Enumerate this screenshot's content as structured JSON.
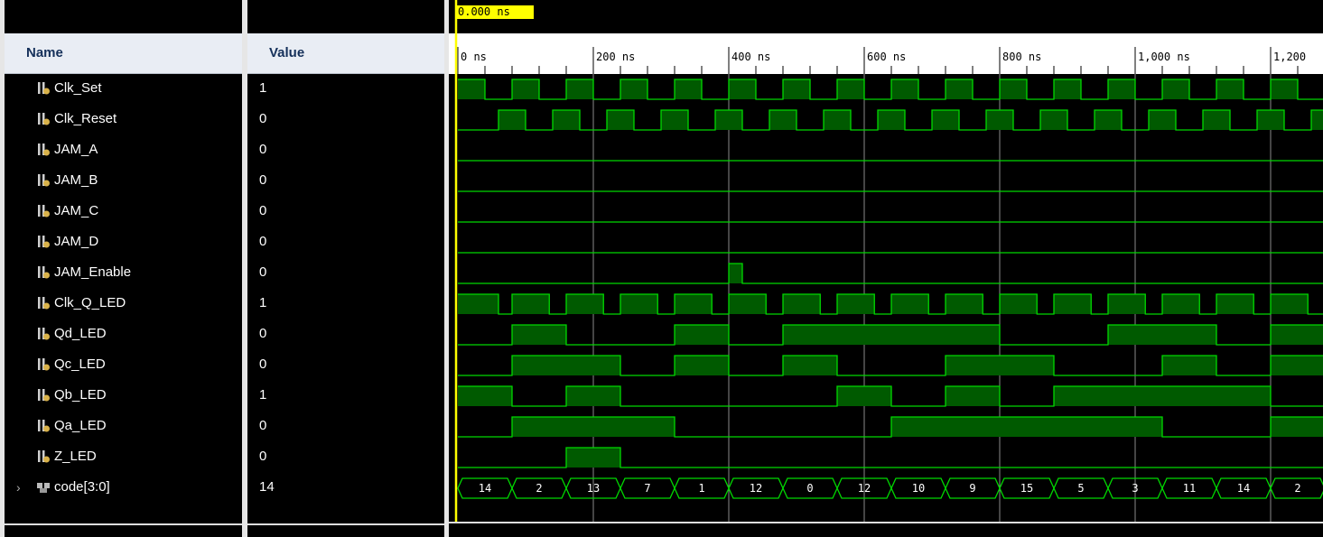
{
  "cursor_label": "0.000 ns",
  "columns": {
    "name": "Name",
    "value": "Value"
  },
  "ruler": [
    "0 ns",
    "200 ns",
    "400 ns",
    "600 ns",
    "800 ns",
    "1,000 ns",
    "1,200"
  ],
  "signals": [
    {
      "name": "Clk_Set",
      "value": "1",
      "icon": "logic-signal-icon"
    },
    {
      "name": "Clk_Reset",
      "value": "0",
      "icon": "logic-signal-icon"
    },
    {
      "name": "JAM_A",
      "value": "0",
      "icon": "logic-signal-icon"
    },
    {
      "name": "JAM_B",
      "value": "0",
      "icon": "logic-signal-icon"
    },
    {
      "name": "JAM_C",
      "value": "0",
      "icon": "logic-signal-icon"
    },
    {
      "name": "JAM_D",
      "value": "0",
      "icon": "logic-signal-icon"
    },
    {
      "name": "JAM_Enable",
      "value": "0",
      "icon": "logic-signal-icon"
    },
    {
      "name": "Clk_Q_LED",
      "value": "1",
      "icon": "logic-signal-icon"
    },
    {
      "name": "Qd_LED",
      "value": "0",
      "icon": "logic-signal-icon"
    },
    {
      "name": "Qc_LED",
      "value": "0",
      "icon": "logic-signal-icon"
    },
    {
      "name": "Qb_LED",
      "value": "1",
      "icon": "logic-signal-icon"
    },
    {
      "name": "Qa_LED",
      "value": "0",
      "icon": "logic-signal-icon"
    },
    {
      "name": "Z_LED",
      "value": "0",
      "icon": "logic-signal-icon"
    },
    {
      "name": "code[3:0]",
      "value": "14",
      "icon": "bus-signal-icon"
    }
  ],
  "bus_values": [
    "14",
    "2",
    "13",
    "7",
    "1",
    "12",
    "0",
    "12",
    "10",
    "9",
    "15",
    "5",
    "3",
    "11",
    "14",
    "2"
  ],
  "colors": {
    "wave": "#00d800",
    "fill": "#005a00",
    "cursor": "#ffff00",
    "grid": "#8a8a8a"
  }
}
